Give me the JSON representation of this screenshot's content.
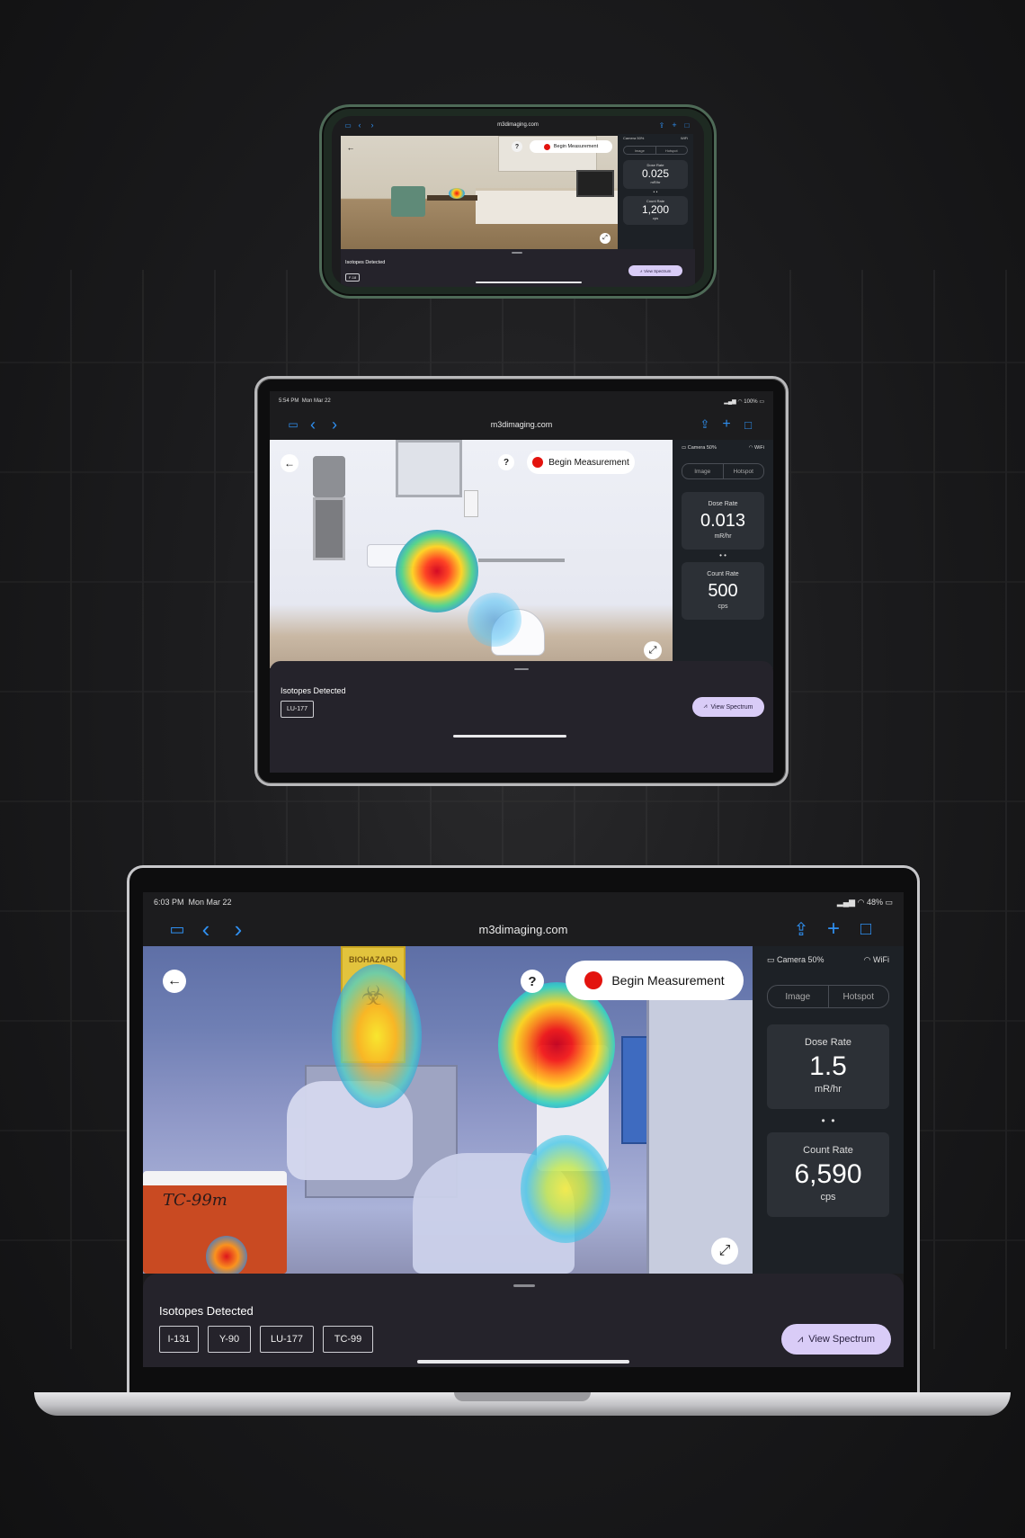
{
  "site": {
    "url": "m3dimaging.com"
  },
  "labels": {
    "begin_measurement": "Begin Measurement",
    "isotopes_detected": "Isotopes Detected",
    "view_spectrum": "View Spectrum",
    "tab_image": "Image",
    "tab_hotspot": "Hotspot",
    "camera": "Camera 50%",
    "wifi": "WiFi",
    "dose_rate": "Dose Rate",
    "count_rate": "Count Rate",
    "help": "?"
  },
  "phone": {
    "dose_value": "0.025",
    "dose_unit": "mR/hr",
    "count_value": "1,200",
    "count_unit": "cps",
    "isotopes": [
      "F-18"
    ]
  },
  "tablet": {
    "time": "5:54 PM",
    "date": "Mon Mar 22",
    "battery": "100%",
    "dose_value": "0.013",
    "dose_unit": "mR/hr",
    "count_value": "500",
    "count_unit": "cps",
    "isotopes": [
      "LU-177"
    ]
  },
  "laptop": {
    "time": "6:03 PM",
    "date": "Mon Mar 22",
    "battery": "48%",
    "dose_value": "1.5",
    "dose_unit": "mR/hr",
    "count_value": "6,590",
    "count_unit": "cps",
    "isotopes": [
      "I-131",
      "Y-90",
      "LU-177",
      "TC-99"
    ]
  },
  "scene_text": {
    "biohazard": "BIOHAZARD",
    "container_note": "TC-99m"
  },
  "colors": {
    "accent": "#2f8ff0",
    "record": "#e3130e",
    "spectrum_button": "#d9ccf7",
    "panel": "#1d2126",
    "card": "#2c3036"
  }
}
